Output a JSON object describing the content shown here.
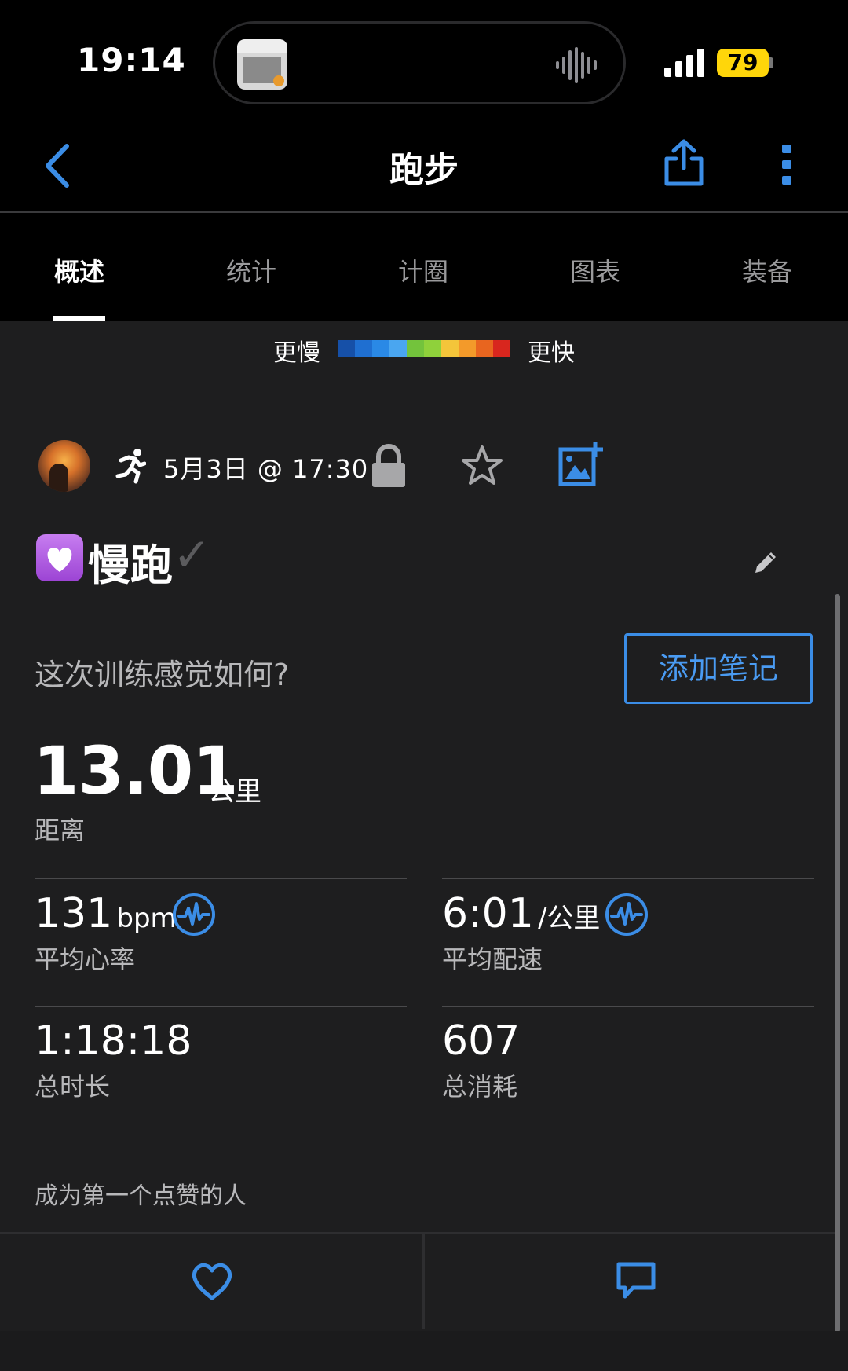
{
  "status_bar": {
    "time": "19:14",
    "battery": "79",
    "now_playing_art": "album-art"
  },
  "nav": {
    "title": "跑步",
    "back_icon": "chevron-left-icon",
    "share_icon": "share-icon",
    "more_icon": "more-vertical-icon"
  },
  "tabs": [
    {
      "label": "概述",
      "active": true
    },
    {
      "label": "统计",
      "active": false
    },
    {
      "label": "计圈",
      "active": false
    },
    {
      "label": "图表",
      "active": false
    },
    {
      "label": "装备",
      "active": false
    }
  ],
  "pace_legend": {
    "slow_label": "更慢",
    "fast_label": "更快",
    "colors": [
      "#1650a8",
      "#1f6fd1",
      "#2a89e6",
      "#4aa6f0",
      "#73c33c",
      "#8fd13b",
      "#f4c53a",
      "#f39a2a",
      "#e8651f",
      "#d8261e"
    ]
  },
  "activity": {
    "datetime": "5月3日 @ 17:30",
    "title": "慢跑",
    "title_emoji": "white-heart-emoji",
    "title_check": "✓",
    "feel_question": "这次训练感觉如何?",
    "add_note_label": "添加笔记"
  },
  "distance": {
    "value": "13.01",
    "unit": "公里",
    "label": "距离"
  },
  "stats": [
    {
      "value": "131",
      "unit": "bpm",
      "label": "平均心率",
      "has_chart_icon": true
    },
    {
      "value": "6:01",
      "unit": "/公里",
      "label": "平均配速",
      "has_chart_icon": true
    },
    {
      "value": "1:18:18",
      "unit": "",
      "label": "总时长",
      "has_chart_icon": false
    },
    {
      "value": "607",
      "unit": "",
      "label": "总消耗",
      "has_chart_icon": false
    }
  ],
  "social": {
    "likes_text": "成为第一个点赞的人"
  },
  "accent_color": "#3b8de6"
}
